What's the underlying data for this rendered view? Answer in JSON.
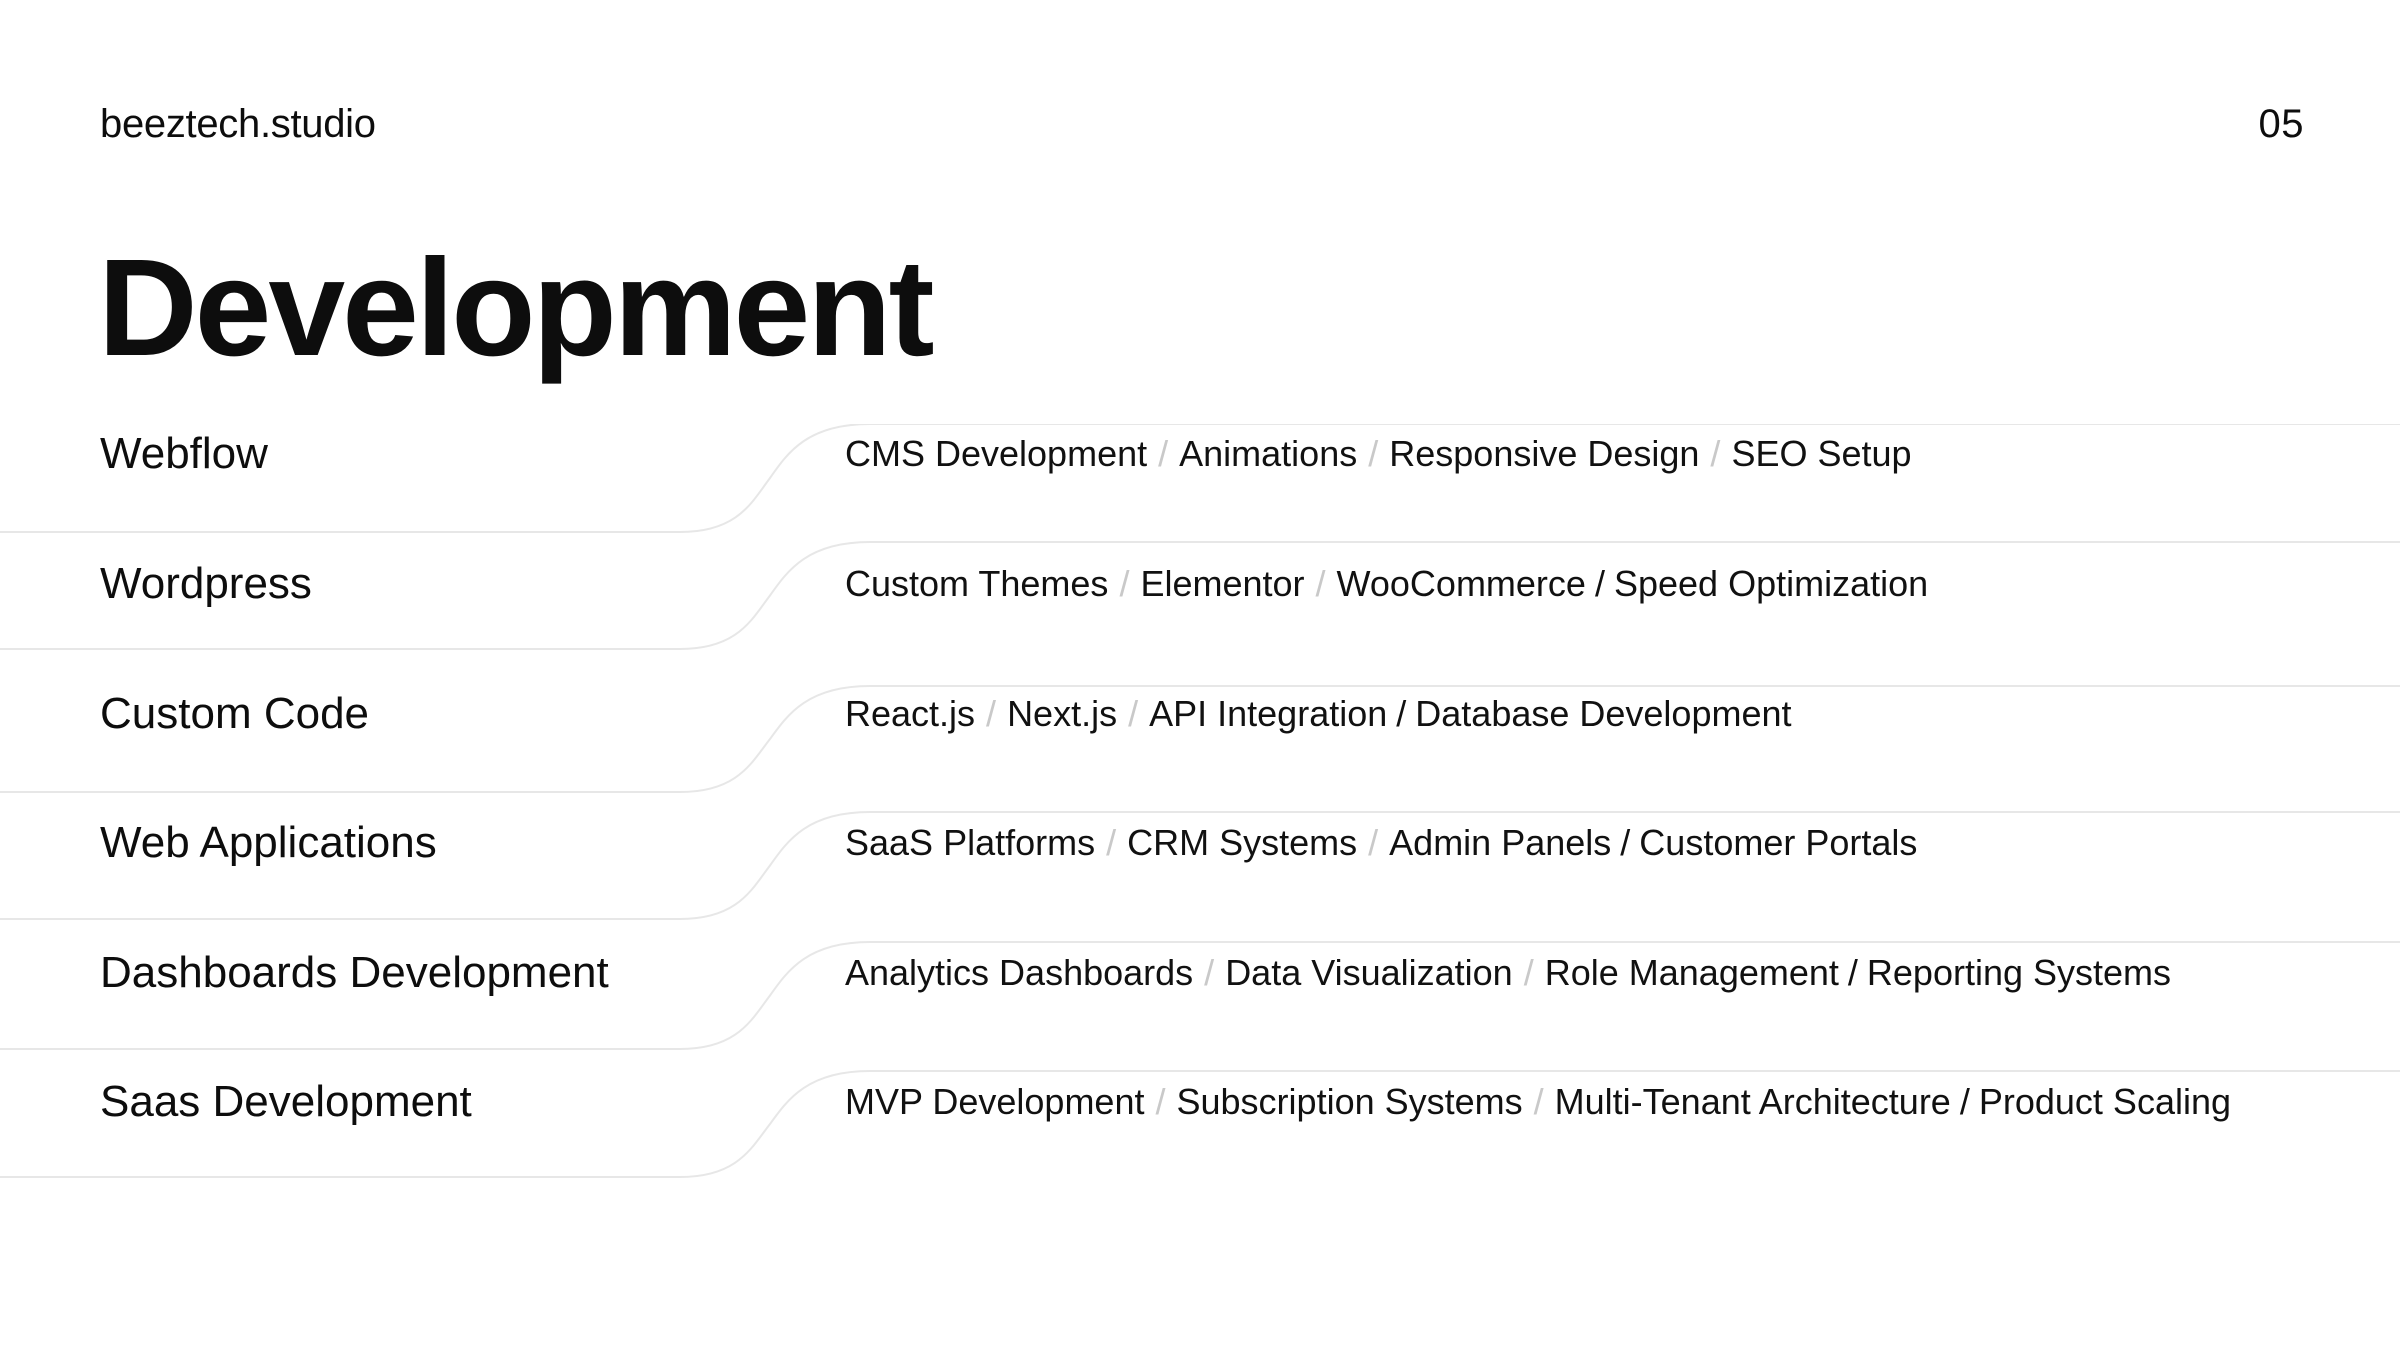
{
  "header": {
    "brand": "beeztech.studio",
    "page_number": "05"
  },
  "title": "Development",
  "services": [
    {
      "title": "Webflow",
      "tags": [
        "CMS Development",
        "Animations",
        "Responsive Design",
        "SEO Setup"
      ],
      "separators": [
        "light",
        "light",
        "light"
      ]
    },
    {
      "title": "Wordpress",
      "tags": [
        "Custom Themes",
        "Elementor",
        "WooCommerce",
        "Speed Optimization"
      ],
      "separators": [
        "light",
        "light",
        "dark"
      ]
    },
    {
      "title": "Custom Code",
      "tags": [
        "React.js",
        "Next.js",
        "API Integration",
        "Database Development"
      ],
      "separators": [
        "light",
        "light",
        "dark"
      ]
    },
    {
      "title": "Web Applications",
      "tags": [
        "SaaS Platforms",
        "CRM Systems",
        "Admin Panels",
        "Customer Portals"
      ],
      "separators": [
        "light",
        "light",
        "dark"
      ]
    },
    {
      "title": "Dashboards Development",
      "tags": [
        "Analytics Dashboards",
        "Data Visualization",
        "Role Management",
        "Reporting Systems"
      ],
      "separators": [
        "light",
        "light",
        "dark"
      ]
    },
    {
      "title": "Saas Development",
      "tags": [
        "MVP Development",
        "Subscription Systems",
        "Multi-Tenant Architecture",
        "Product Scaling"
      ],
      "separators": [
        "light",
        "light",
        "dark"
      ]
    }
  ],
  "separator_glyph": "/",
  "colors": {
    "background": "#ffffff",
    "text": "#0d0d0d",
    "divider": "#e7e7e7",
    "separator_light": "#c9c9c9"
  }
}
